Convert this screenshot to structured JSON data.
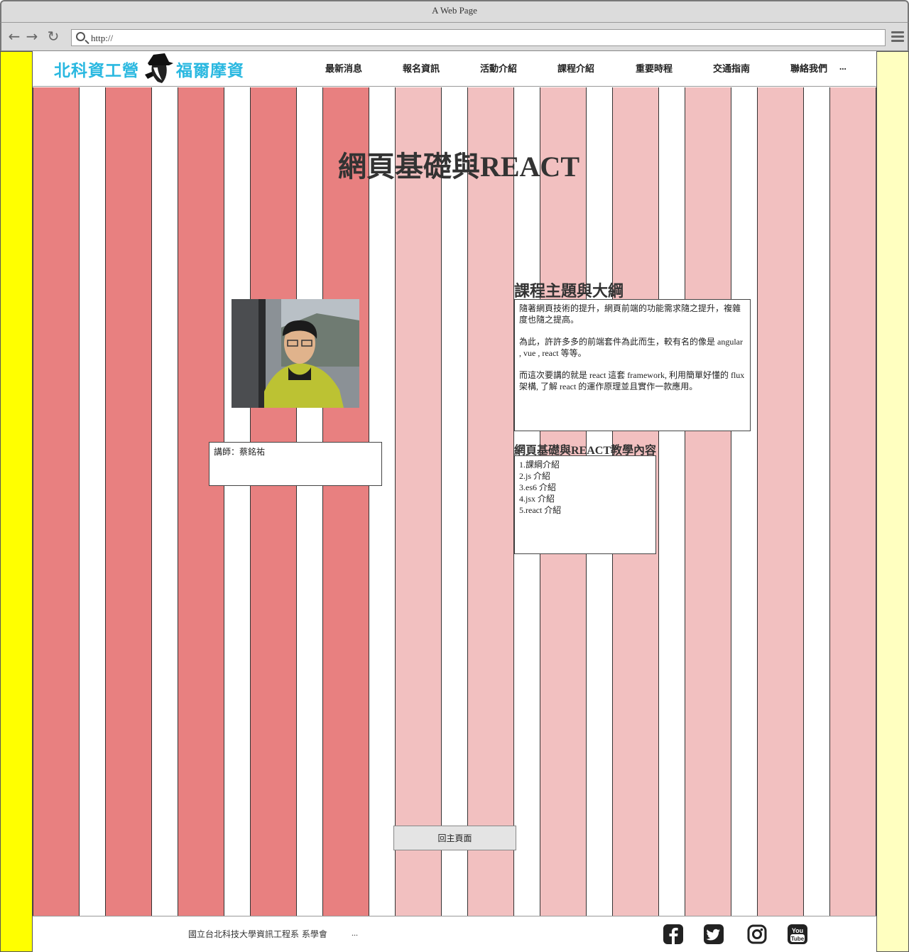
{
  "window": {
    "title": "A Web Page"
  },
  "browser": {
    "url": "http://"
  },
  "header": {
    "logo_left": "北科資工營",
    "logo_right": "福爾摩資",
    "nav": [
      "最新消息",
      "報名資訊",
      "活動介紹",
      "課程介紹",
      "重要時程",
      "交通指南",
      "聯絡我們",
      "..."
    ]
  },
  "colors": {
    "left_panel": "#ffff00",
    "right_panel": "#ffffc0",
    "stripe_dark": "#e88080",
    "stripe_light": "#f2c0c0",
    "logo_text": "#2ab8e0"
  },
  "course": {
    "title": "網頁基礎與REACT",
    "instructor_label": "講師：蔡銘祐",
    "outline_title": "課程主題與大綱",
    "outline_paragraphs": [
      "隨著網頁技術的提升，網頁前端的功能需求隨之提升，複雜度也隨之提高。",
      "為此，許許多多的前端套件為此而生，較有名的像是 angular , vue , react 等等。",
      "而這次要講的就是 react 這套 framework, 利用簡單好懂的 flux 架構, 了解 react 的運作原理並且實作一款應用。"
    ],
    "content_title": "網頁基礎與REACT教學內容",
    "content_items": [
      "1.課綱介紹",
      "2.js 介紹",
      "3.es6 介紹",
      "4.jsx 介紹",
      "5.react 介紹"
    ]
  },
  "back_button": "回主頁面",
  "footer": {
    "text": "國立台北科技大學資訊工程系 系學會",
    "ellipsis": "...",
    "social_icons": [
      "facebook-icon",
      "twitter-icon",
      "instagram-icon",
      "youtube-icon"
    ]
  }
}
